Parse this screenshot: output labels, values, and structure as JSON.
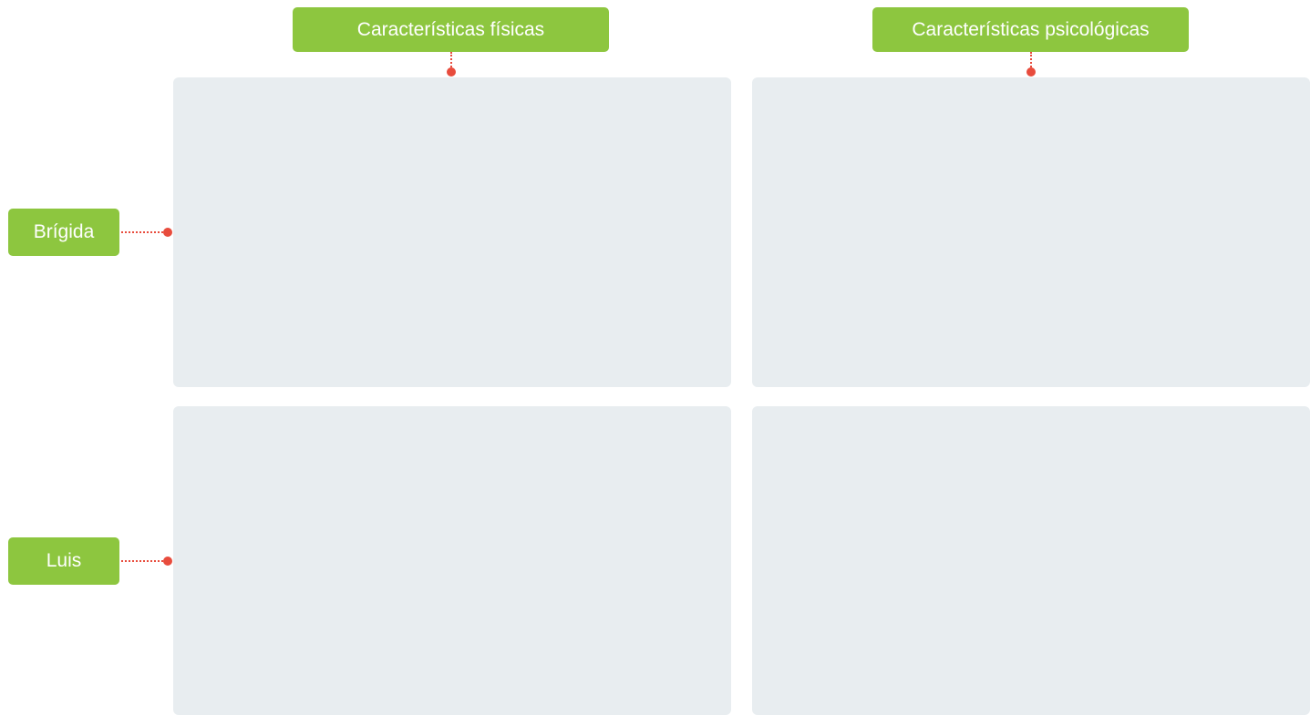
{
  "columns": [
    {
      "label": "Características físicas"
    },
    {
      "label": "Características psicológicas"
    }
  ],
  "rows": [
    {
      "label": "Brígida"
    },
    {
      "label": "Luis"
    }
  ],
  "colors": {
    "label_bg": "#8dc63f",
    "label_text": "#ffffff",
    "connector": "#e84c3d",
    "cell_bg": "#e8edf0"
  }
}
